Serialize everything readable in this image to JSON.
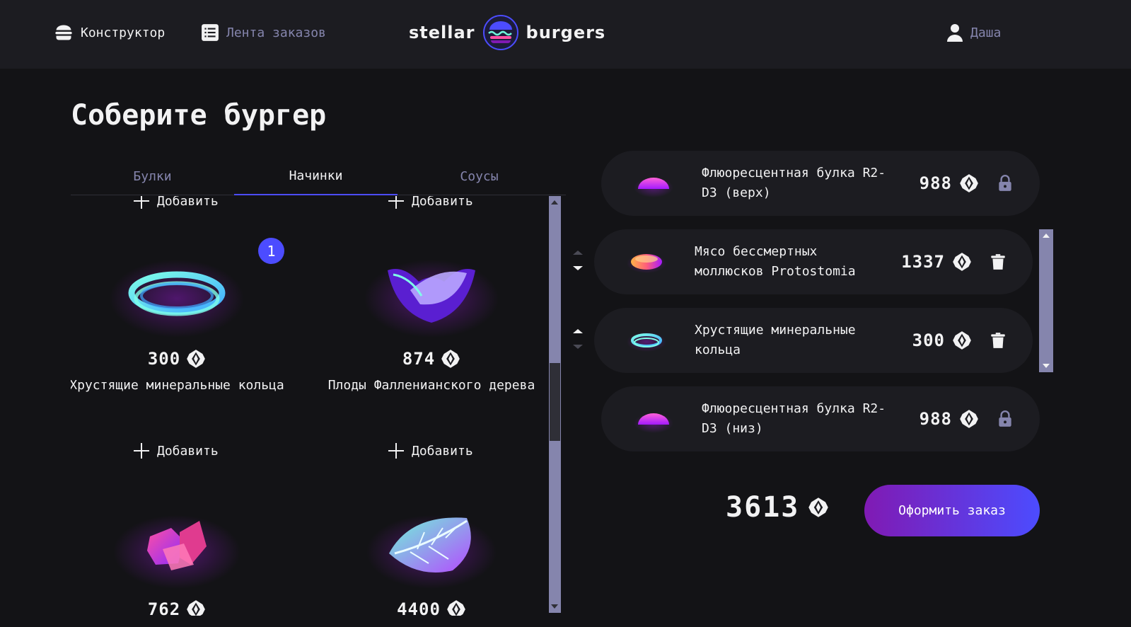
{
  "header": {
    "constructor_label": "Конструктор",
    "feed_label": "Лента заказов",
    "logo_left": "stellar",
    "logo_right": "burgers",
    "profile_label": "Даша"
  },
  "page_title": "Соберите бургер",
  "tabs": [
    {
      "label": "Булки",
      "active": false
    },
    {
      "label": "Начинки",
      "active": true
    },
    {
      "label": "Соусы",
      "active": false
    }
  ],
  "ingredients": {
    "add_label": "Добавить",
    "cards": [
      {
        "name": "Хрустящие минеральные кольца",
        "price": "300",
        "counter": "1",
        "icon": "mineral-rings"
      },
      {
        "name": "Плоды Фалленианского дерева",
        "price": "874",
        "icon": "fallen-fruit"
      },
      {
        "name": "",
        "price": "762",
        "icon": "crystals"
      },
      {
        "name": "",
        "price": "4400",
        "icon": "leaf"
      }
    ]
  },
  "constructor": {
    "items": [
      {
        "name": "Флюоресцентная булка R2-D3 (верх)",
        "price": "988",
        "locked": true
      },
      {
        "name": "Мясо бессмертных моллюсков Protostomia",
        "price": "1337",
        "locked": false
      },
      {
        "name": "Хрустящие минеральные кольца",
        "price": "300",
        "locked": false
      },
      {
        "name": "Флюоресцентная булка R2-D3 (низ)",
        "price": "988",
        "locked": true
      }
    ],
    "total": "3613",
    "order_button": "Оформить заказ"
  },
  "colors": {
    "accent": "#4c4cff",
    "inactive": "#8585ad",
    "panel": "#1c1c21",
    "background": "#131316"
  }
}
